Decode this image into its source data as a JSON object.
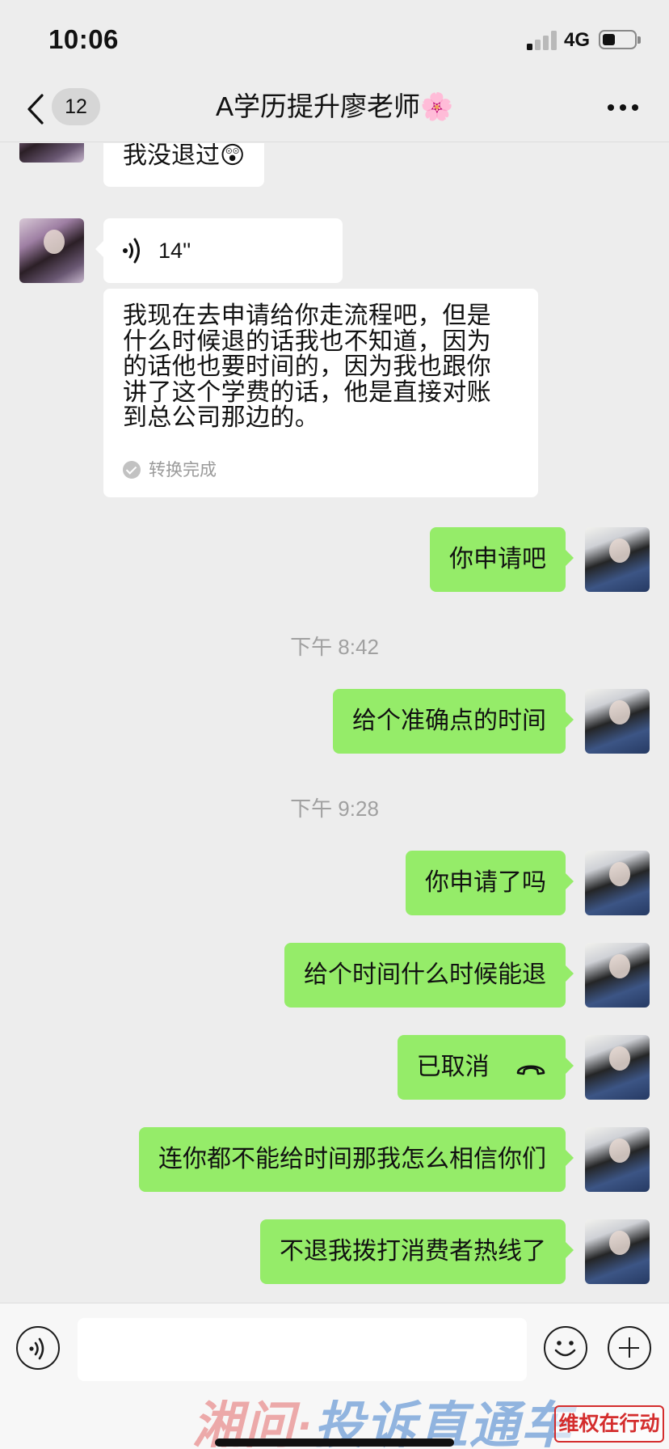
{
  "status_bar": {
    "time": "10:06",
    "network": "4G",
    "battery_level": 0.4
  },
  "nav": {
    "unread_count": "12",
    "title": "A学历提升廖老师🌸"
  },
  "messages": [
    {
      "sender": "other",
      "type": "text",
      "text": "我没退过😲"
    },
    {
      "sender": "other",
      "type": "voice",
      "duration": "14''"
    },
    {
      "sender": "other",
      "type": "transcript",
      "lines": [
        "我现在去申请给你走流程吧，但是",
        "什么时候退的话我也不知道，因为",
        "的话他也要时间的，因为我也跟你",
        "讲了这个学费的话，他是直接对账",
        "到总公司那边的。"
      ],
      "status": "转换完成"
    },
    {
      "sender": "me",
      "type": "text",
      "text": "你申请吧"
    },
    {
      "type": "timestamp",
      "text": "下午 8:42"
    },
    {
      "sender": "me",
      "type": "text",
      "text": "给个准确点的时间"
    },
    {
      "type": "timestamp",
      "text": "下午 9:28"
    },
    {
      "sender": "me",
      "type": "text",
      "text": "你申请了吗"
    },
    {
      "sender": "me",
      "type": "text",
      "text": "给个时间什么时候能退"
    },
    {
      "sender": "me",
      "type": "call",
      "text": "已取消"
    },
    {
      "sender": "me",
      "type": "text",
      "text": "连你都不能给时间那我怎么相信你们"
    },
    {
      "sender": "me",
      "type": "text",
      "text": "不退我拨打消费者热线了"
    }
  ],
  "input_bar": {
    "placeholder": ""
  },
  "watermark": {
    "left_text": "湘问·",
    "right_text": "投诉直通车",
    "stamp": "维权在行动"
  },
  "colors": {
    "background": "#ededed",
    "my_bubble": "#95ec69",
    "other_bubble": "#ffffff",
    "timestamp_text": "#a0a0a0"
  },
  "icons": [
    "back-chevron-icon",
    "more-icon",
    "voice-wave-icon",
    "check-icon",
    "phone-hangup-icon",
    "voice-input-icon",
    "emoji-icon",
    "plus-icon"
  ]
}
